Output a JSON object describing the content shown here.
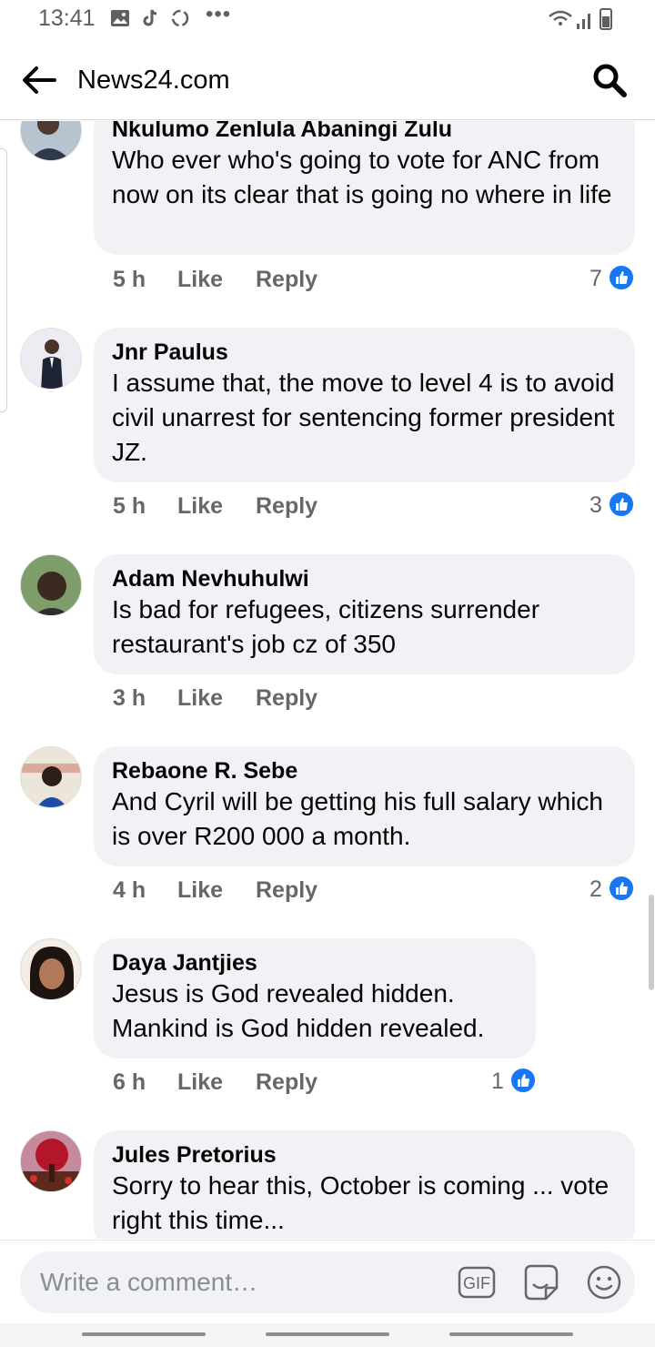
{
  "status_bar": {
    "time": "13:41",
    "more": "•••"
  },
  "header": {
    "title": "News24.com"
  },
  "comments": [
    {
      "name": "Nkulumo Zenlula Abaningi Zulu",
      "text": "Who ever who's going to vote for ANC from now on its clear that is going no where in life",
      "time": "5 h",
      "like_label": "Like",
      "reply_label": "Reply",
      "reactions": "7",
      "avatar_color": "#8aa0b4"
    },
    {
      "name": "Jnr Paulus",
      "text": "I assume that, the move to level 4 is to avoid civil unarrest for sentencing former president JZ.",
      "time": "5 h",
      "like_label": "Like",
      "reply_label": "Reply",
      "reactions": "3",
      "avatar_color": "#e8e6ef"
    },
    {
      "name": "Adam Nevhuhulwi",
      "text": "Is bad for refugees, citizens surrender restaurant's job cz of 350",
      "time": "3 h",
      "like_label": "Like",
      "reply_label": "Reply",
      "reactions": "",
      "avatar_color": "#6d8a5a"
    },
    {
      "name": "Rebaone R. Sebe",
      "text": "And Cyril will be getting his full salary which is over R200 000 a month.",
      "time": "4 h",
      "like_label": "Like",
      "reply_label": "Reply",
      "reactions": "2",
      "avatar_color": "#d9d2c4"
    },
    {
      "name": "Daya Jantjies",
      "text": "Jesus is God revealed hidden. Mankind is God hidden revealed.",
      "time": "6 h",
      "like_label": "Like",
      "reply_label": "Reply",
      "reactions": "1",
      "avatar_color": "#c9a58c"
    },
    {
      "name": "Jules Pretorius",
      "text": "Sorry to hear this, October is coming ... vote right this time...",
      "time": "",
      "like_label": "",
      "reply_label": "",
      "reactions": "",
      "avatar_color": "#9d6b7a"
    }
  ],
  "composer": {
    "placeholder": "Write a comment…"
  },
  "colors": {
    "like_blue": "#1877f2",
    "bubble": "#f0f2f5",
    "secondary_text": "#65676b"
  }
}
